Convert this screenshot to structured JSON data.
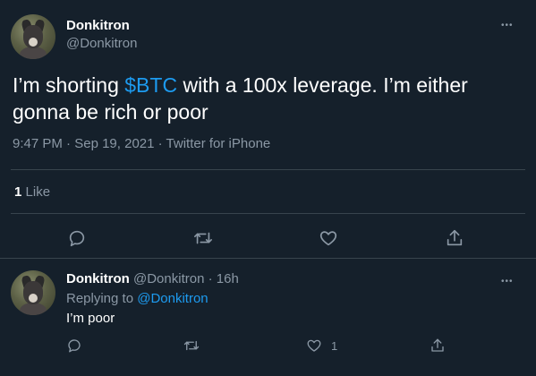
{
  "main_tweet": {
    "author_name": "Donkitron",
    "author_handle": "@Donkitron",
    "text_part1": "I’m shorting ",
    "cashtag": "$BTC",
    "text_part2": " with a 100x leverage. I’m either gonna be rich or poor",
    "time": "9:47 PM",
    "date": "Sep 19, 2021",
    "source": "Twitter for iPhone",
    "separator": " · ",
    "like_count": "1",
    "like_label": "Like"
  },
  "reply_tweet": {
    "author_name": "Donkitron",
    "author_handle": "@Donkitron",
    "separator": " · ",
    "time_ago": "16h",
    "replying_to_label": "Replying to ",
    "replying_to_handle": "@Donkitron",
    "text": "I’m poor",
    "like_count": "1"
  },
  "icons": {
    "more": "more-icon",
    "reply": "reply-icon",
    "retweet": "retweet-icon",
    "like": "heart-icon",
    "share": "share-icon"
  },
  "colors": {
    "background": "#15202b",
    "text": "#ffffff",
    "secondary": "#8b98a5",
    "accent": "#1d9bf0",
    "divider": "#38444d"
  },
  "more_glyph": "•••"
}
